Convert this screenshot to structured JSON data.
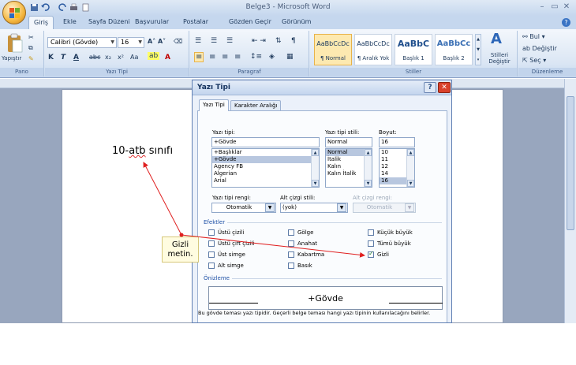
{
  "window": {
    "title": "Belge3 - Microsoft Word"
  },
  "ribbon_tabs": [
    "Giriş",
    "Ekle",
    "Sayfa Düzeni",
    "Başvurular",
    "Postalar",
    "Gözden Geçir",
    "Görünüm"
  ],
  "ribbon": {
    "pano": {
      "paste": "Yapıştır",
      "label": "Pano"
    },
    "font": {
      "name": "Calibri (Gövde)",
      "size": "16",
      "label": "Yazı Tipi"
    },
    "paragraph": {
      "label": "Paragraf"
    },
    "styles": {
      "items": [
        {
          "sample": "AaBbCcDc",
          "name": "¶ Normal"
        },
        {
          "sample": "AaBbCcDc",
          "name": "¶ Aralık Yok"
        },
        {
          "sample": "AaBbC",
          "name": "Başlık 1"
        },
        {
          "sample": "AaBbCc",
          "name": "Başlık 2"
        }
      ],
      "change": "Stilleri Değiştir",
      "label": "Stiller"
    },
    "editing": {
      "find": "Bul",
      "replace": "Değiştir",
      "select": "Seç",
      "label": "Düzenleme"
    }
  },
  "document": {
    "text_before": "10-",
    "text_squiggle": "atb",
    "text_after": " sınıfı"
  },
  "callout": {
    "line1": "Gizli",
    "line2": "metin."
  },
  "dialog": {
    "title": "Yazı Tipi",
    "tabs": [
      "Yazı Tipi",
      "Karakter Aralığı"
    ],
    "font_label": "Yazı tipi:",
    "font_value": "+Gövde",
    "font_list": [
      "+Başlıklar",
      "+Gövde",
      "Agency FB",
      "Algerian",
      "Arial"
    ],
    "style_label": "Yazı tipi stili:",
    "style_value": "Normal",
    "style_list": [
      "Normal",
      "İtalik",
      "Kalın",
      "Kalın İtalik"
    ],
    "size_label": "Boyut:",
    "size_value": "16",
    "size_list": [
      "10",
      "11",
      "12",
      "14",
      "16"
    ],
    "color_label": "Yazı tipi rengi:",
    "color_value": "Otomatik",
    "underline_label": "Alt çizgi stili:",
    "underline_value": "(yok)",
    "ucolor_label": "Alt çizgi rengi:",
    "ucolor_value": "Otomatik",
    "effects_label": "Efektler",
    "effects": [
      {
        "label": "Üstü çizili",
        "checked": false
      },
      {
        "label": "Üstü çift çizili",
        "checked": false
      },
      {
        "label": "Üst simge",
        "checked": false
      },
      {
        "label": "Alt simge",
        "checked": false
      },
      {
        "label": "Gölge",
        "checked": false
      },
      {
        "label": "Anahat",
        "checked": false
      },
      {
        "label": "Kabartma",
        "checked": false
      },
      {
        "label": "Basık",
        "checked": false
      },
      {
        "label": "Küçük büyük",
        "checked": false
      },
      {
        "label": "Tümü büyük",
        "checked": false
      },
      {
        "label": "Gizli",
        "checked": true
      }
    ],
    "preview_label": "Önizleme",
    "preview_text": "+Gövde",
    "note": "Bu gövde teması yazı tipidir. Geçerli belge teması hangi yazı tipinin kullanılacağını belirler."
  },
  "colors": {
    "accent": "#c5d7ee",
    "arrow": "#e02020",
    "close": "#d9412b"
  },
  "icons": [
    "office-logo-icon",
    "save-icon",
    "undo-icon",
    "redo-icon",
    "print-icon",
    "paste-icon",
    "help-icon",
    "close-icon"
  ]
}
